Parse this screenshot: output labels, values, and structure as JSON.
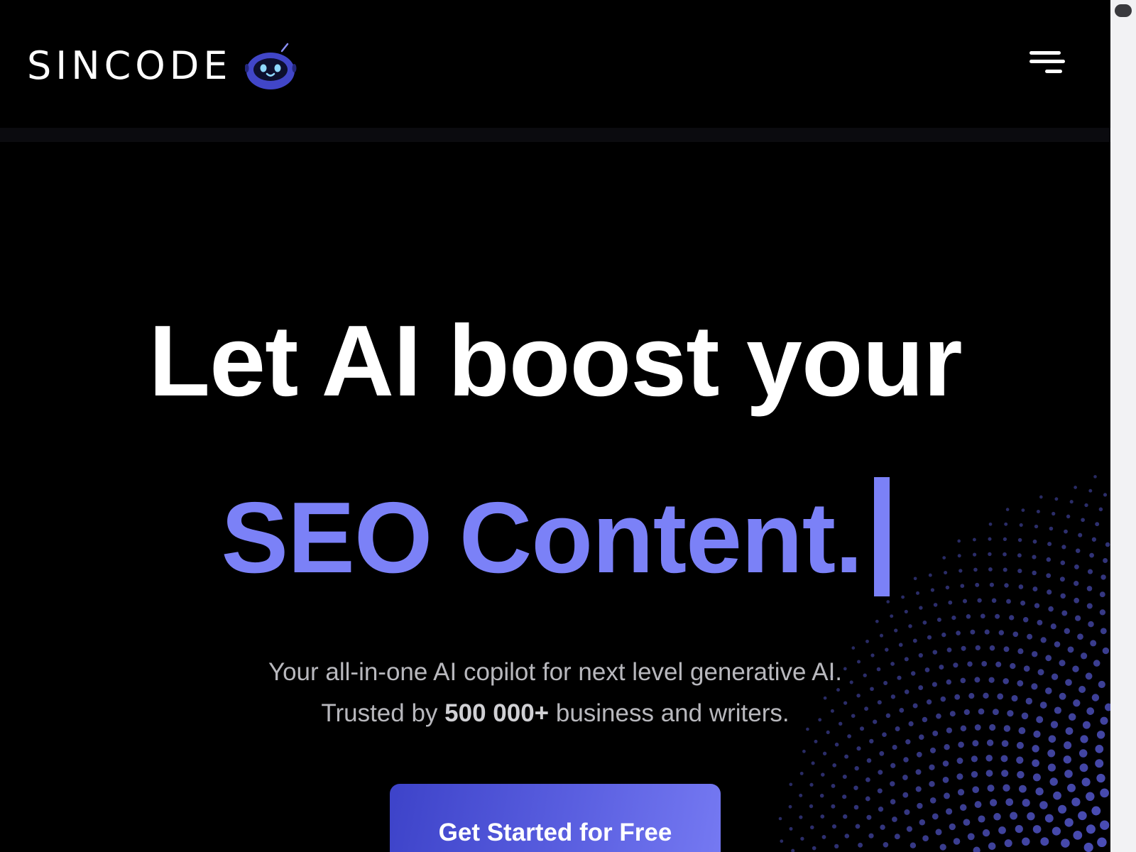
{
  "header": {
    "logo_text": "SINCODE",
    "logo_icon": "robot-mascot-icon",
    "menu_icon": "hamburger-menu-icon"
  },
  "hero": {
    "headline_line1": "Let AI boost your",
    "headline_line2": "SEO Content.",
    "subtitle_line1": "Your all-in-one AI copilot for next level generative AI.",
    "subtitle_prefix": "Trusted by ",
    "subtitle_count": "500 000+",
    "subtitle_suffix": " business and writers.",
    "cta_label": "Get Started for Free"
  },
  "colors": {
    "background": "#000000",
    "accent": "#7b81f7",
    "button_start": "#3d43c9",
    "button_end": "#7579f2",
    "subtitle": "#b8b8bd",
    "dot": "#5b5fe0"
  }
}
